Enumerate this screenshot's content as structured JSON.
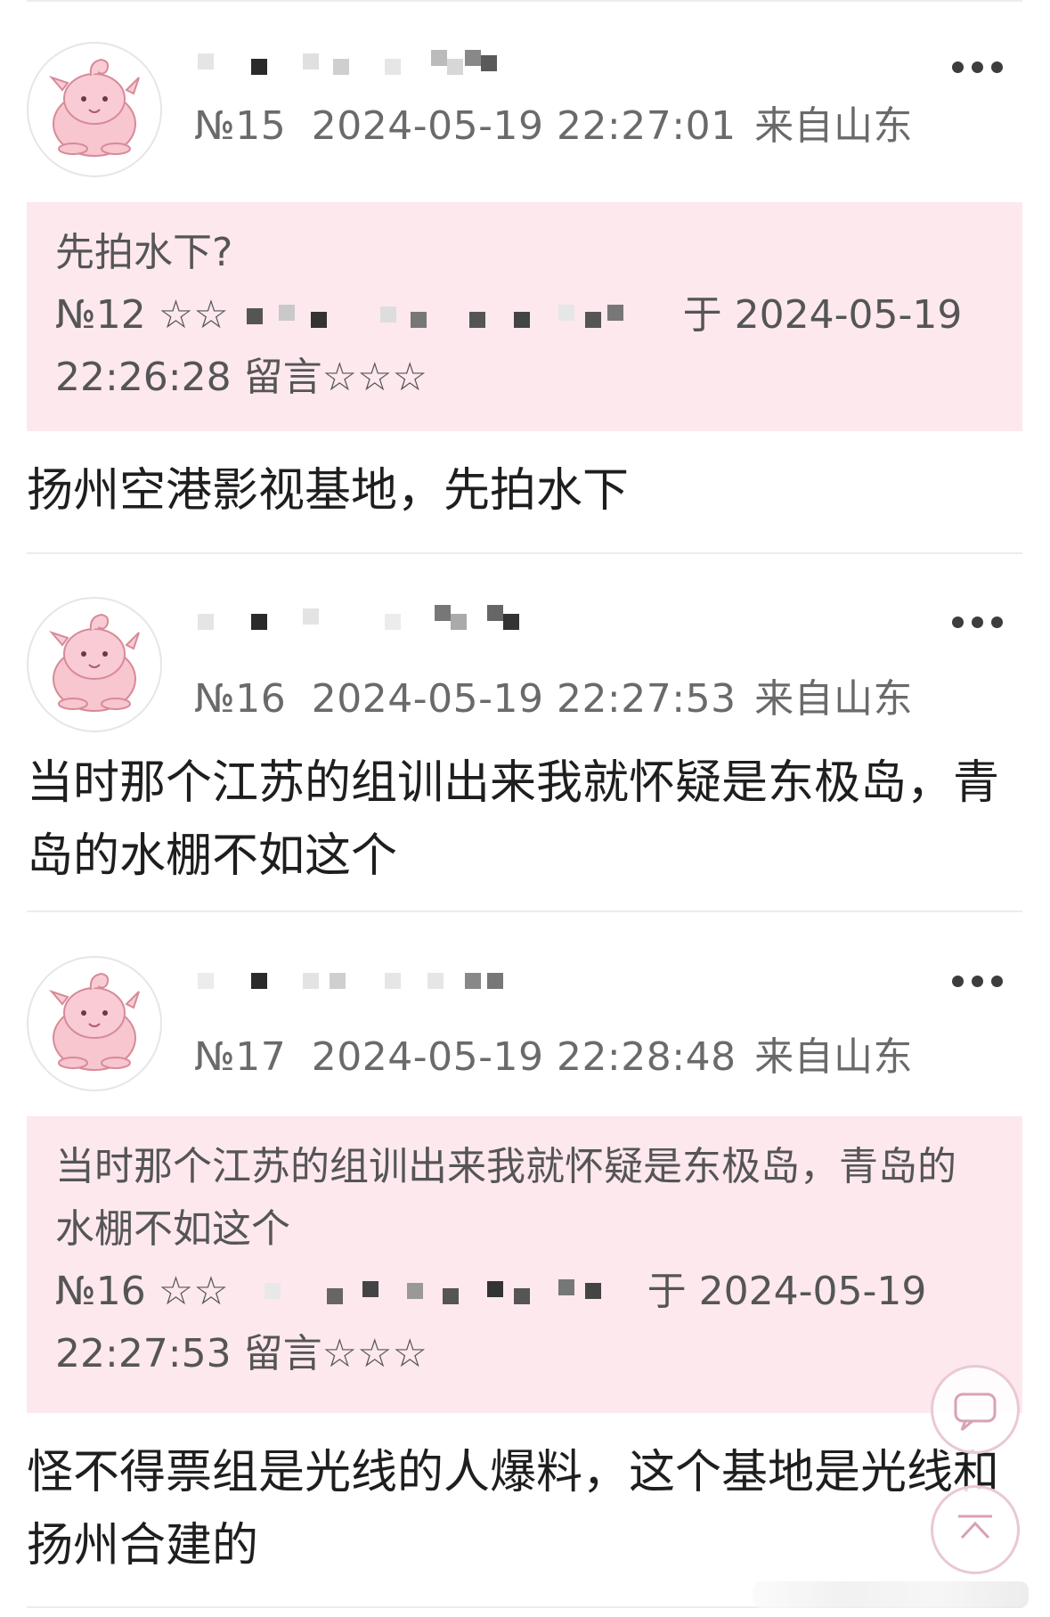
{
  "posts": [
    {
      "floor": "№15",
      "time": "2024-05-19 22:27:01",
      "location": "来自山东",
      "quote": {
        "text": "先拍水下?",
        "floor": "№12",
        "stars_left": "☆☆",
        "at": "于 2024-05-19",
        "time_line2": "22:26:28 留言☆☆☆"
      },
      "content": "扬州空港影视基地，先拍水下"
    },
    {
      "floor": "№16",
      "time": "2024-05-19 22:27:53",
      "location": "来自山东",
      "content": "当时那个江苏的组训出来我就怀疑是东极岛，青岛的水棚不如这个"
    },
    {
      "floor": "№17",
      "time": "2024-05-19 22:28:48",
      "location": "来自山东",
      "quote": {
        "text": "当时那个江苏的组训出来我就怀疑是东极岛，青岛的水棚不如这个",
        "floor": "№16",
        "stars_left": "☆☆",
        "at": "于 2024-05-19",
        "time_line2": "22:27:53 留言☆☆☆"
      },
      "content": "怪不得票组是光线的人爆料，这个基地是光线和扬州合建的"
    }
  ],
  "icons": {
    "more": "more-dots-icon",
    "comment": "comment-bubble-icon",
    "top": "back-to-top-icon",
    "avatar": "pink-creature-avatar"
  },
  "colors": {
    "quote_bg": "#fde8ee",
    "meta_text": "#6a6a6a",
    "float_border": "#e9c9d2"
  }
}
